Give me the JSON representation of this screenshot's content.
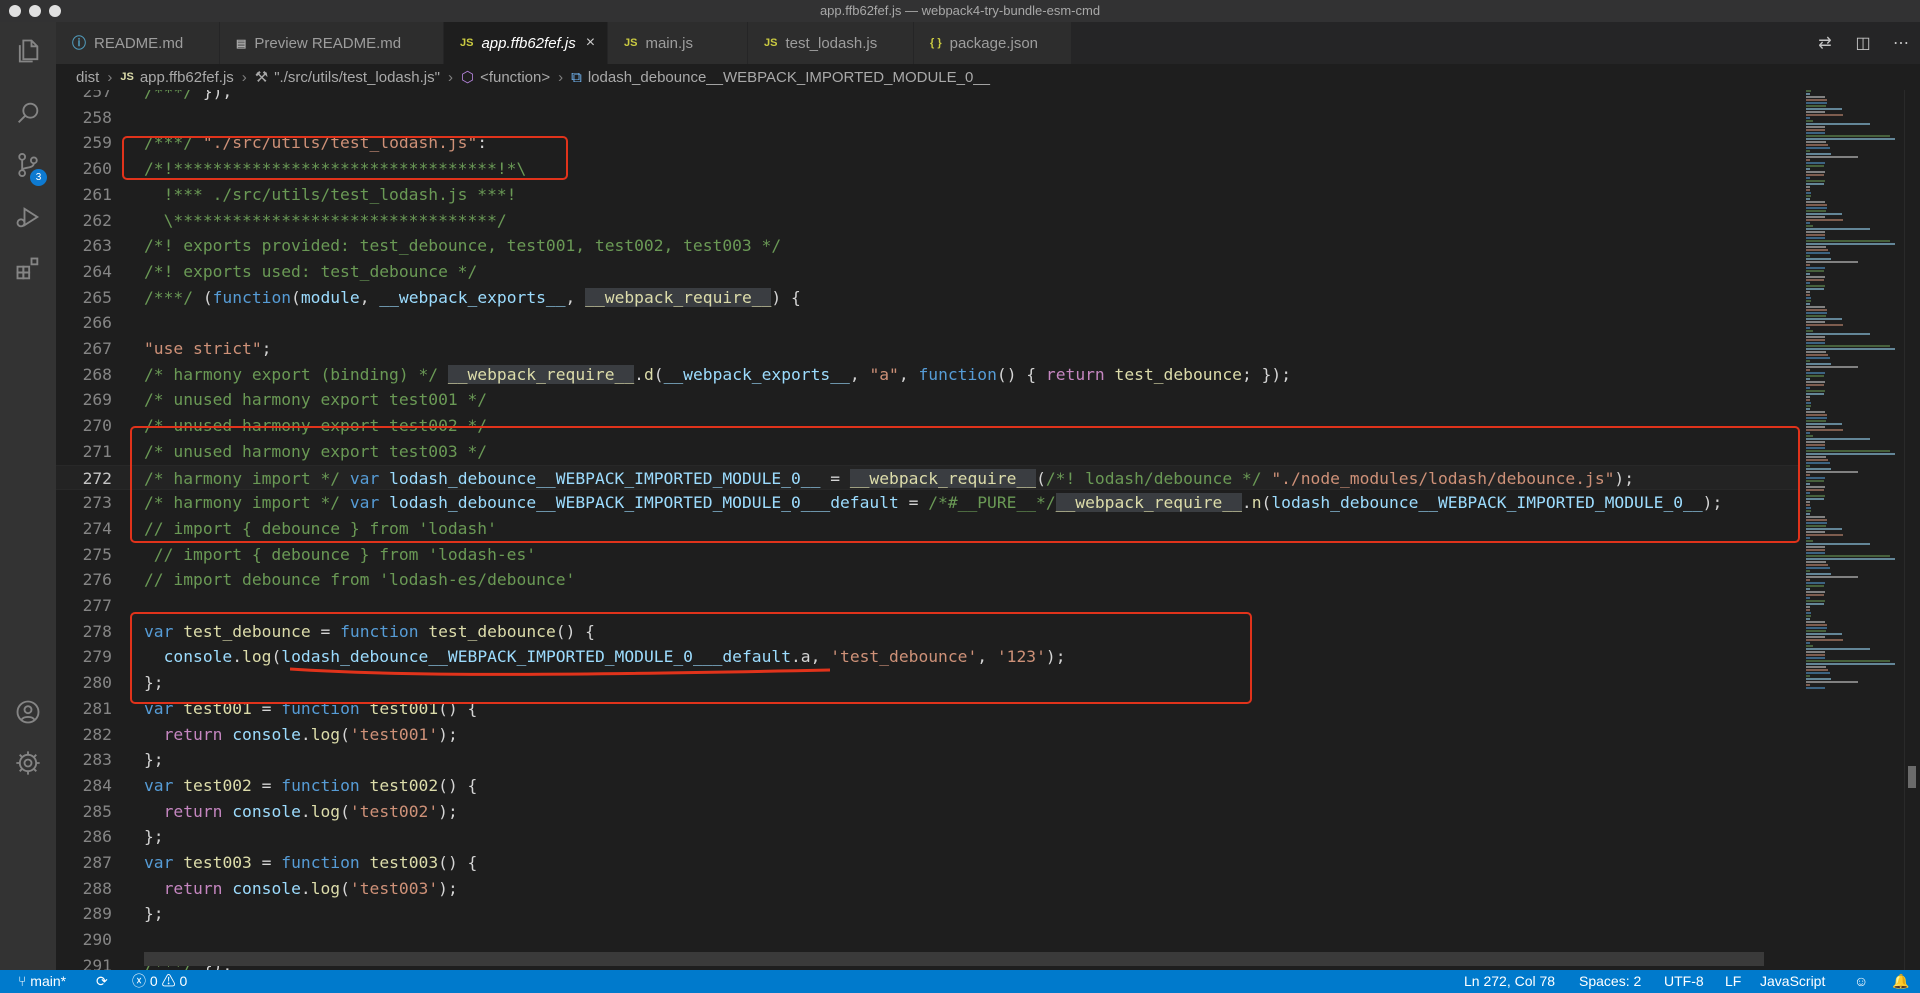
{
  "window": {
    "title": "app.ffb62fef.js — webpack4-try-bundle-esm-cmd"
  },
  "activity_bar": {
    "items": [
      {
        "name": "explorer",
        "icon": "files-icon"
      },
      {
        "name": "search",
        "icon": "search-icon"
      },
      {
        "name": "source-control",
        "icon": "source-control-icon",
        "badge": "3"
      },
      {
        "name": "run-debug",
        "icon": "debug-icon"
      },
      {
        "name": "extensions",
        "icon": "extensions-icon"
      }
    ],
    "bottom": [
      {
        "name": "accounts",
        "icon": "account-icon"
      },
      {
        "name": "manage",
        "icon": "gear-icon"
      }
    ]
  },
  "tabs": [
    {
      "label": "README.md",
      "icon": "md",
      "active": false
    },
    {
      "label": "Preview README.md",
      "icon": "prev",
      "active": false
    },
    {
      "label": "app.ffb62fef.js",
      "icon": "js",
      "active": true
    },
    {
      "label": "main.js",
      "icon": "js",
      "active": false
    },
    {
      "label": "test_lodash.js",
      "icon": "js",
      "active": false
    },
    {
      "label": "package.json",
      "icon": "json",
      "active": false
    }
  ],
  "tab_icons": {
    "js": "JS",
    "md": "ⓘ",
    "prev": "▤",
    "json": "{ }",
    "close": "×"
  },
  "breadcrumb": {
    "items": [
      "dist",
      "app.ffb62fef.js",
      "\"./src/utils/test_lodash.js\"",
      "<function>",
      "lodash_debounce__WEBPACK_IMPORTED_MODULE_0__"
    ]
  },
  "editor": {
    "language": "javascript",
    "current_line": 272,
    "lines": [
      {
        "n": "257",
        "t": "/***/ }),",
        "c": "def"
      },
      {
        "n": "258",
        "t": "",
        "c": "def"
      },
      {
        "n": "259",
        "t": "/***/ \"./src/utils/test_lodash.js\":",
        "c": "def"
      },
      {
        "n": "260",
        "t": "/*!*********************************!*\\",
        "c": "cm"
      },
      {
        "n": "261",
        "t": "  !*** ./src/utils/test_lodash.js ***!",
        "c": "cm"
      },
      {
        "n": "262",
        "t": "  \\*********************************/",
        "c": "cm"
      },
      {
        "n": "263",
        "t": "/*! exports provided: test_debounce, test001, test002, test003 */",
        "c": "cm"
      },
      {
        "n": "264",
        "t": "/*! exports used: test_debounce */",
        "c": "cm"
      },
      {
        "n": "265",
        "t": "/***/ (function(module, __webpack_exports__, __webpack_require__) {",
        "c": "def"
      },
      {
        "n": "266",
        "t": "",
        "c": "def"
      },
      {
        "n": "267",
        "t": "\"use strict\";",
        "c": "str"
      },
      {
        "n": "268",
        "t": "/* harmony export (binding) */ __webpack_require__.d(__webpack_exports__, \"a\", function() { return test_debounce; });",
        "c": "def"
      },
      {
        "n": "269",
        "t": "/* unused harmony export test001 */",
        "c": "cm"
      },
      {
        "n": "270",
        "t": "/* unused harmony export test002 */",
        "c": "cm"
      },
      {
        "n": "271",
        "t": "/* unused harmony export test003 */",
        "c": "cm"
      },
      {
        "n": "272",
        "t": "/* harmony import */ var lodash_debounce__WEBPACK_IMPORTED_MODULE_0__ = __webpack_require__(/*! lodash/debounce */ \"./node_modules/lodash/debounce.js\");",
        "c": "def"
      },
      {
        "n": "273",
        "t": "/* harmony import */ var lodash_debounce__WEBPACK_IMPORTED_MODULE_0___default = /*#__PURE__*/__webpack_require__.n(lodash_debounce__WEBPACK_IMPORTED_MODULE_0__);",
        "c": "def"
      },
      {
        "n": "274",
        "t": "// import { debounce } from 'lodash'",
        "c": "cm"
      },
      {
        "n": "275",
        "t": " // import { debounce } from 'lodash-es'",
        "c": "cm"
      },
      {
        "n": "276",
        "t": "// import debounce from 'lodash-es/debounce'",
        "c": "cm"
      },
      {
        "n": "277",
        "t": "",
        "c": "def"
      },
      {
        "n": "278",
        "t": "var test_debounce = function test_debounce() {",
        "c": "def"
      },
      {
        "n": "279",
        "t": "  console.log(lodash_debounce__WEBPACK_IMPORTED_MODULE_0___default.a, 'test_debounce', '123');",
        "c": "def"
      },
      {
        "n": "280",
        "t": "};",
        "c": "def"
      },
      {
        "n": "281",
        "t": "var test001 = function test001() {",
        "c": "def"
      },
      {
        "n": "282",
        "t": "  return console.log('test001');",
        "c": "def"
      },
      {
        "n": "283",
        "t": "};",
        "c": "def"
      },
      {
        "n": "284",
        "t": "var test002 = function test002() {",
        "c": "def"
      },
      {
        "n": "285",
        "t": "  return console.log('test002');",
        "c": "def"
      },
      {
        "n": "286",
        "t": "};",
        "c": "def"
      },
      {
        "n": "287",
        "t": "var test003 = function test003() {",
        "c": "def"
      },
      {
        "n": "288",
        "t": "  return console.log('test003');",
        "c": "def"
      },
      {
        "n": "289",
        "t": "};",
        "c": "def"
      },
      {
        "n": "290",
        "t": "",
        "c": "def"
      },
      {
        "n": "291",
        "t": "/***/ }),",
        "c": "def"
      }
    ]
  },
  "status_bar": {
    "branch": "main*",
    "sync_icon": "⟳",
    "errors": "0",
    "warnings": "0",
    "cursor": "Ln 272, Col 78",
    "indent": "Spaces: 2",
    "encoding": "UTF-8",
    "eol": "LF",
    "language": "JavaScript"
  },
  "colors": {
    "status_bar": "#007acc",
    "annotation": "#e1331b",
    "comment": "#6a9955",
    "keyword": "#569cd6",
    "string": "#ce9178"
  }
}
